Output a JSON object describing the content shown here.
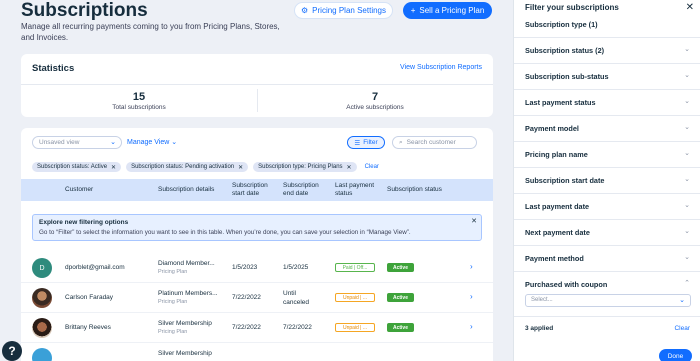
{
  "header": {
    "title": "Subscriptions",
    "subtitle": "Manage all recurring payments coming to you from Pricing Plans, Stores, and Invoices.",
    "pricing_settings_label": "Pricing Plan Settings",
    "sell_label": "Sell a Pricing Plan"
  },
  "stats": {
    "title": "Statistics",
    "link": "View Subscription Reports",
    "items": [
      {
        "value": "15",
        "label": "Total subscriptions"
      },
      {
        "value": "7",
        "label": "Active subscriptions"
      }
    ]
  },
  "toolbar": {
    "view_select": "Unsaved view",
    "manage_view": "Manage View",
    "filter_label": "Filter",
    "search_placeholder": "Search customer"
  },
  "chips": [
    "Subscription status: Active",
    "Subscription status: Pending activation",
    "Subscription type: Pricing Plans"
  ],
  "chips_clear": "Clear",
  "table": {
    "headers": {
      "customer": "Customer",
      "details": "Subscription details",
      "start": "Subscription start date",
      "end": "Subscription end date",
      "last_payment": "Last payment status",
      "status": "Subscription status"
    },
    "banner": {
      "title": "Explore new filtering options",
      "body": "Go to “Filter” to select the information you want to see in this table. When you’re done, you can save your selection in “Manage View”."
    },
    "rows": [
      {
        "initial": "D",
        "customer": "dporblet@gmail.com",
        "plan": "Diamond Member...",
        "plan_type": "Pricing Plan",
        "start": "1/5/2023",
        "end": "1/5/2025",
        "payment": "Paid | Off...",
        "status": "Active"
      },
      {
        "initial": "",
        "customer": "Carlson Faraday",
        "plan": "Platinum Members...",
        "plan_type": "Pricing Plan",
        "start": "7/22/2022",
        "end": "Until canceled",
        "payment": "Unpaid | ...",
        "status": "Active"
      },
      {
        "initial": "",
        "customer": "Brittany Reeves",
        "plan": "Silver Membership",
        "plan_type": "Pricing Plan",
        "start": "7/22/2022",
        "end": "7/22/2022",
        "payment": "Unpaid | ...",
        "status": "Active"
      },
      {
        "initial": "",
        "customer": "",
        "plan": "Silver Membership",
        "plan_type": "",
        "start": "",
        "end": "",
        "payment": "",
        "status": ""
      }
    ]
  },
  "panel": {
    "title": "Filter your subscriptions",
    "partial_top": "Subscription type (1)",
    "items": [
      {
        "label": "Subscription status (2)"
      },
      {
        "label": "Subscription sub-status"
      },
      {
        "label": "Last payment status"
      },
      {
        "label": "Payment model"
      },
      {
        "label": "Pricing plan name"
      },
      {
        "label": "Subscription start date"
      },
      {
        "label": "Last payment date"
      },
      {
        "label": "Next payment date"
      },
      {
        "label": "Payment method"
      },
      {
        "label": "Purchased with coupon"
      }
    ],
    "select_placeholder": "Select...",
    "applied": "3 applied",
    "clear": "Clear",
    "done": "Done"
  },
  "help": "?"
}
